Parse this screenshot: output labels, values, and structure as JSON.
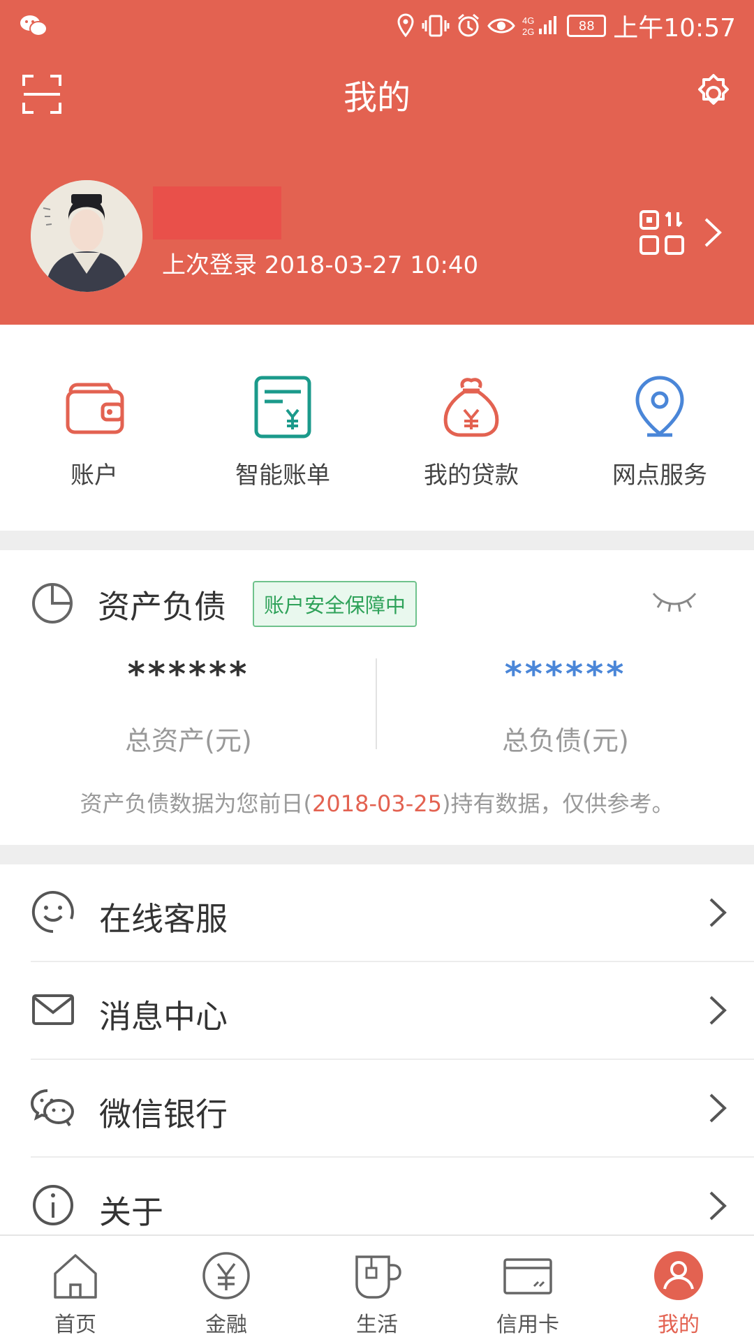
{
  "status": {
    "time": "上午10:57",
    "battery": "88",
    "signal": "4G 2G"
  },
  "header": {
    "title": "我的",
    "last_login": "上次登录 2018-03-27 10:40"
  },
  "quick_actions": [
    {
      "label": "账户",
      "icon": "wallet-icon"
    },
    {
      "label": "智能账单",
      "icon": "bill-icon"
    },
    {
      "label": "我的贷款",
      "icon": "loan-bag-icon"
    },
    {
      "label": "网点服务",
      "icon": "location-icon"
    }
  ],
  "asset": {
    "title": "资产负债",
    "badge": "账户安全保障中",
    "total_assets_value": "******",
    "total_assets_label": "总资产(元)",
    "total_debt_value": "******",
    "total_debt_label": "总负债(元)",
    "note_prefix": "资产负债数据为您前日(",
    "note_date": "2018-03-25",
    "note_suffix": ")持有数据，仅供参考。"
  },
  "menu": [
    {
      "label": "在线客服",
      "icon": "smile-icon"
    },
    {
      "label": "消息中心",
      "icon": "mail-icon"
    },
    {
      "label": "微信银行",
      "icon": "wechat-icon"
    },
    {
      "label": "关于",
      "icon": "info-icon"
    }
  ],
  "nav": [
    {
      "label": "首页",
      "icon": "home-icon"
    },
    {
      "label": "金融",
      "icon": "finance-icon"
    },
    {
      "label": "生活",
      "icon": "cup-icon"
    },
    {
      "label": "信用卡",
      "icon": "card-icon"
    },
    {
      "label": "我的",
      "icon": "user-icon"
    }
  ],
  "colors": {
    "brand": "#e36251",
    "safe_green": "#2fa25a",
    "debt_blue": "#4a86d8"
  }
}
